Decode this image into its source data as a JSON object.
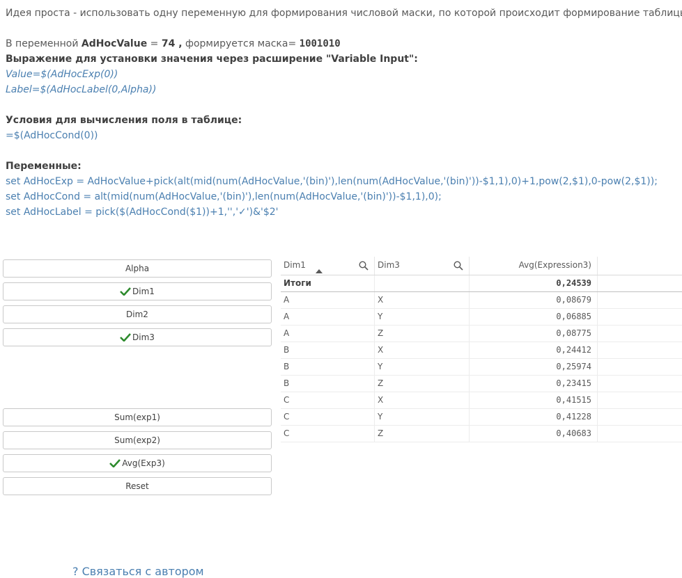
{
  "intro": "Идея проста - использовать одну переменную для формирования числовой маски, по которой происходит формирование таблицы.",
  "mask_line": {
    "prefix": "В переменной",
    "var_name": "AdHocValue",
    "eq": " = ",
    "value": "74 ,",
    "middle": " формируется маска= ",
    "mask": "1001010"
  },
  "expr_heading": "Выражение для установки значения через расширение \"Variable Input\":",
  "expr_value": "Value=$(AdHocExp(0))",
  "expr_label": "Label=$(AdHocLabel(0,Alpha))",
  "cond_heading": "Условия для вычисления поля в таблице:",
  "cond_expr": "=$(AdHocCond(0))",
  "vars_heading": "Переменные:",
  "vars": [
    "set AdHocExp = AdHocValue+pick(alt(mid(num(AdHocValue,'(bin)'),len(num(AdHocValue,'(bin)'))-$1,1),0)+1,pow(2,$1),0-pow(2,$1));",
    "set AdHocCond = alt(mid(num(AdHocValue,'(bin)'),len(num(AdHocValue,'(bin)'))-$1,1),0);",
    "set AdHocLabel = pick($(AdHocCond($1))+1,'','✓')&'$2'"
  ],
  "buttons_top": [
    {
      "label": "Alpha",
      "checked": false
    },
    {
      "label": "Dim1",
      "checked": true
    },
    {
      "label": "Dim2",
      "checked": false
    },
    {
      "label": "Dim3",
      "checked": true
    }
  ],
  "buttons_bottom": [
    {
      "label": "Sum(exp1)",
      "checked": false
    },
    {
      "label": "Sum(exp2)",
      "checked": false
    },
    {
      "label": "Avg(Exp3)",
      "checked": true
    },
    {
      "label": "Reset",
      "checked": false
    }
  ],
  "table": {
    "headers": [
      "Dim1",
      "Dim3",
      "Avg(Expression3)"
    ],
    "total_label": "Итоги",
    "total_value": "0,24539",
    "rows": [
      [
        "A",
        "X",
        "0,08679"
      ],
      [
        "A",
        "Y",
        "0,06885"
      ],
      [
        "A",
        "Z",
        "0,08775"
      ],
      [
        "B",
        "X",
        "0,24412"
      ],
      [
        "B",
        "Y",
        "0,25974"
      ],
      [
        "B",
        "Z",
        "0,23415"
      ],
      [
        "C",
        "X",
        "0,41515"
      ],
      [
        "C",
        "Y",
        "0,41228"
      ],
      [
        "C",
        "Z",
        "0,40683"
      ]
    ]
  },
  "contact": "Связаться с автором",
  "colors": {
    "link": "#4a7fb0",
    "check": "#2e8b2e",
    "border": "#c8c8c8"
  }
}
